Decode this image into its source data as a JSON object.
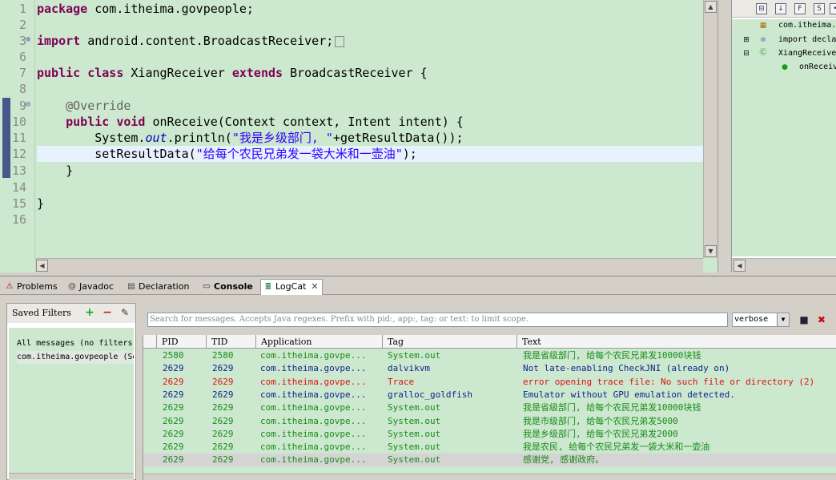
{
  "editor": {
    "line_numbers": [
      "1",
      "2",
      "3",
      "6",
      "7",
      "8",
      "9",
      "10",
      "11",
      "12",
      "13",
      "14",
      "15",
      "16"
    ],
    "lines": {
      "l1_kw": "package",
      "l1_rest": " com.itheima.govpeople;",
      "l3_kw": "import",
      "l3_rest": " android.content.BroadcastReceiver;",
      "l6_kw1": "public",
      "l6_kw2": "class",
      "l6_mid": " XiangReceiver ",
      "l6_kw3": "extends",
      "l6_rest": " BroadcastReceiver {",
      "l8_ann": "@Override",
      "l9_kw1": "public",
      "l9_kw2": "void",
      "l9_rest": " onReceive(Context context, Intent intent) {",
      "l10_a": "System.",
      "l10_fld": "out",
      "l10_b": ".println(",
      "l10_str": "\"我是乡级部门, \"",
      "l10_c": "+getResultData());",
      "l11_a": "setResultData(",
      "l11_str": "\"给每个农民兄弟发一袋大米和一壶油\"",
      "l11_c": ");",
      "l12": "}",
      "l14": "}"
    }
  },
  "outline": {
    "items": [
      "com.itheima.",
      "import decla",
      "XiangReceive",
      "onReceiv"
    ]
  },
  "tabs": [
    {
      "label": "Problems"
    },
    {
      "label": "Javadoc"
    },
    {
      "label": "Declaration"
    },
    {
      "label": "Console"
    },
    {
      "label": "LogCat",
      "close": "✕"
    }
  ],
  "logcat": {
    "filters_title": "Saved Filters",
    "filters": [
      "All messages (no filters)",
      "com.itheima.govpeople (Session Filter)"
    ],
    "search_placeholder": "Search for messages. Accepts Java regexes. Prefix with pid:, app:, tag: or text: to limit scope.",
    "level": "verbose",
    "columns": [
      "PID",
      "TID",
      "Application",
      "Tag",
      "Text"
    ],
    "rows": [
      {
        "pid": "2580",
        "tid": "2580",
        "app": "com.itheima.govpe...",
        "tag": "System.out",
        "text": "我是省级部门, 给每个农民兄弟发10000块钱",
        "level": "info"
      },
      {
        "pid": "2629",
        "tid": "2629",
        "app": "com.itheima.govpe...",
        "tag": "dalvikvm",
        "text": "Not late-enabling CheckJNI (already on)",
        "level": "debug"
      },
      {
        "pid": "2629",
        "tid": "2629",
        "app": "com.itheima.govpe...",
        "tag": "Trace",
        "text": "error opening trace file: No such file or directory (2)",
        "level": "error"
      },
      {
        "pid": "2629",
        "tid": "2629",
        "app": "com.itheima.govpe...",
        "tag": "gralloc_goldfish",
        "text": "Emulator without GPU emulation detected.",
        "level": "debug"
      },
      {
        "pid": "2629",
        "tid": "2629",
        "app": "com.itheima.govpe...",
        "tag": "System.out",
        "text": "我是省级部门, 给每个农民兄弟发10000块钱",
        "level": "info"
      },
      {
        "pid": "2629",
        "tid": "2629",
        "app": "com.itheima.govpe...",
        "tag": "System.out",
        "text": "我是市级部门, 给每个农民兄弟发5000",
        "level": "info"
      },
      {
        "pid": "2629",
        "tid": "2629",
        "app": "com.itheima.govpe...",
        "tag": "System.out",
        "text": "我是乡级部门, 给每个农民兄弟发2000",
        "level": "info"
      },
      {
        "pid": "2629",
        "tid": "2629",
        "app": "com.itheima.govpe...",
        "tag": "System.out",
        "text": "我是农民, 给每个农民兄弟发一袋大米和一壶油",
        "level": "info"
      },
      {
        "pid": "2629",
        "tid": "2629",
        "app": "com.itheima.govpe...",
        "tag": "System.out",
        "text": "感谢党, 感谢政府。",
        "level": "info"
      }
    ]
  },
  "colors": {
    "editor_bg": "#cce8cf",
    "keyword": "#7f0055",
    "string": "#2a00ff",
    "log_info": "#1a8a1a",
    "log_debug": "#10248c",
    "log_error": "#e01010"
  }
}
